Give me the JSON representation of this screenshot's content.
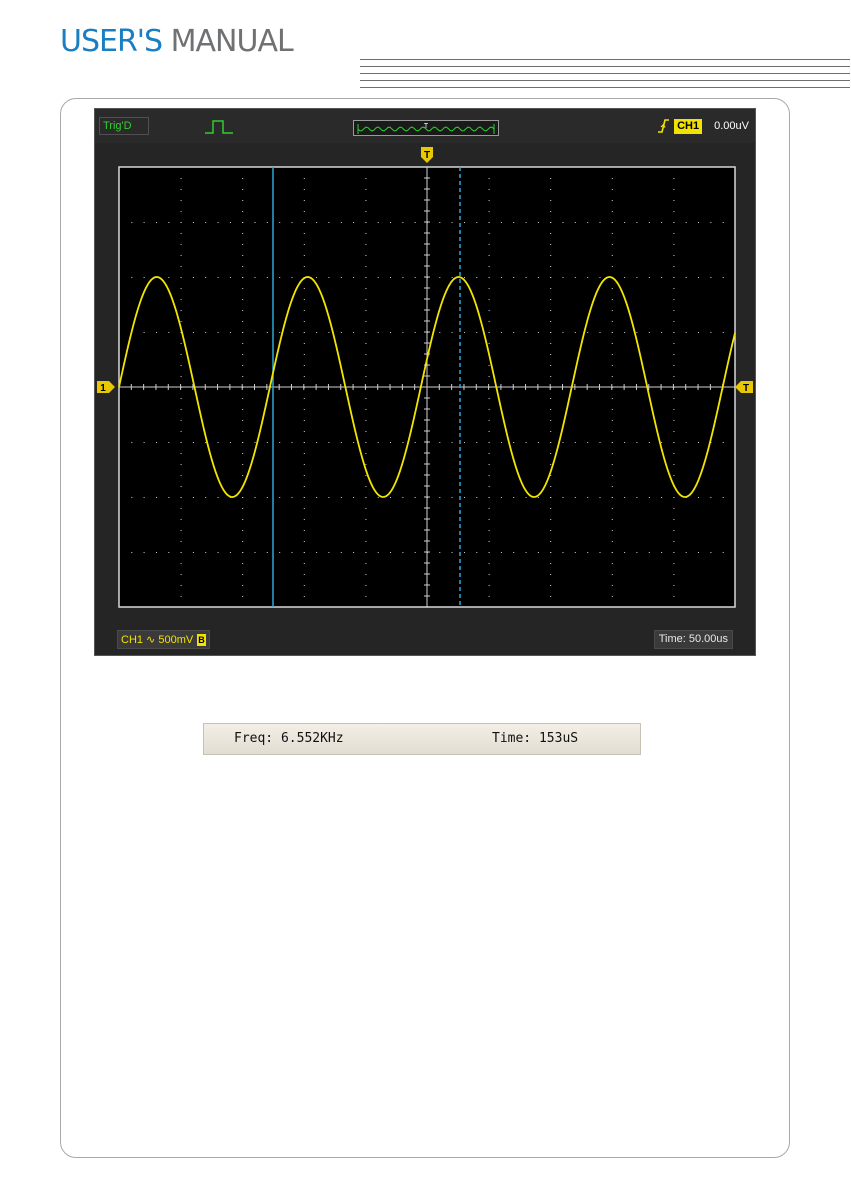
{
  "header": {
    "title_part1": "USER'S",
    "title_part2": "MANUAL"
  },
  "scope": {
    "trigger_status": "Trig'D",
    "trigger_channel": "CH1",
    "trigger_level": "0.00uV",
    "trigger_marker": "T",
    "channel_marker": "1",
    "channel_info": "CH1 ∿ 500mV",
    "bandwidth_badge": "B",
    "timebase": "Time: 50.00us",
    "colors": {
      "trace": "#f2e600",
      "cursor": "#2aa7d8",
      "grid": "#cfcfcf",
      "marker": "#e8c800"
    }
  },
  "status_bar": {
    "freq": "Freq: 6.552KHz",
    "time": "Time: 153uS"
  }
}
